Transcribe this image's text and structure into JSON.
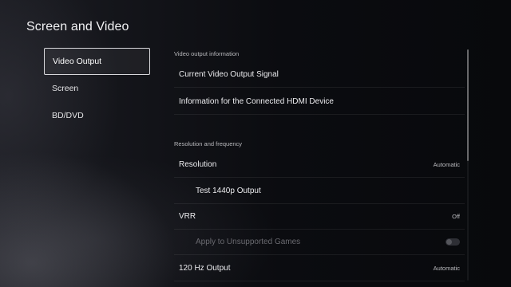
{
  "page": {
    "title": "Screen and Video"
  },
  "nav": {
    "items": [
      {
        "label": "Video Output",
        "active": true
      },
      {
        "label": "Screen",
        "active": false
      },
      {
        "label": "BD/DVD",
        "active": false
      }
    ]
  },
  "sections": {
    "video_output_info": {
      "header": "Video output information",
      "rows": [
        {
          "label": "Current Video Output Signal"
        },
        {
          "label": "Information for the Connected HDMI Device"
        }
      ]
    },
    "resolution_frequency": {
      "header": "Resolution and frequency",
      "rows": [
        {
          "label": "Resolution",
          "value": "Automatic"
        },
        {
          "label": "Test 1440p Output"
        },
        {
          "label": "VRR",
          "value": "Off"
        },
        {
          "label": "Apply to Unsupported Games",
          "toggle": "off",
          "disabled": true
        },
        {
          "label": "120 Hz Output",
          "value": "Automatic"
        }
      ]
    }
  },
  "colors": {
    "background": "#0b0d12",
    "text": "#e8e8ea",
    "muted_text": "#6a6a70",
    "focus_border": "#d8d8dc"
  }
}
